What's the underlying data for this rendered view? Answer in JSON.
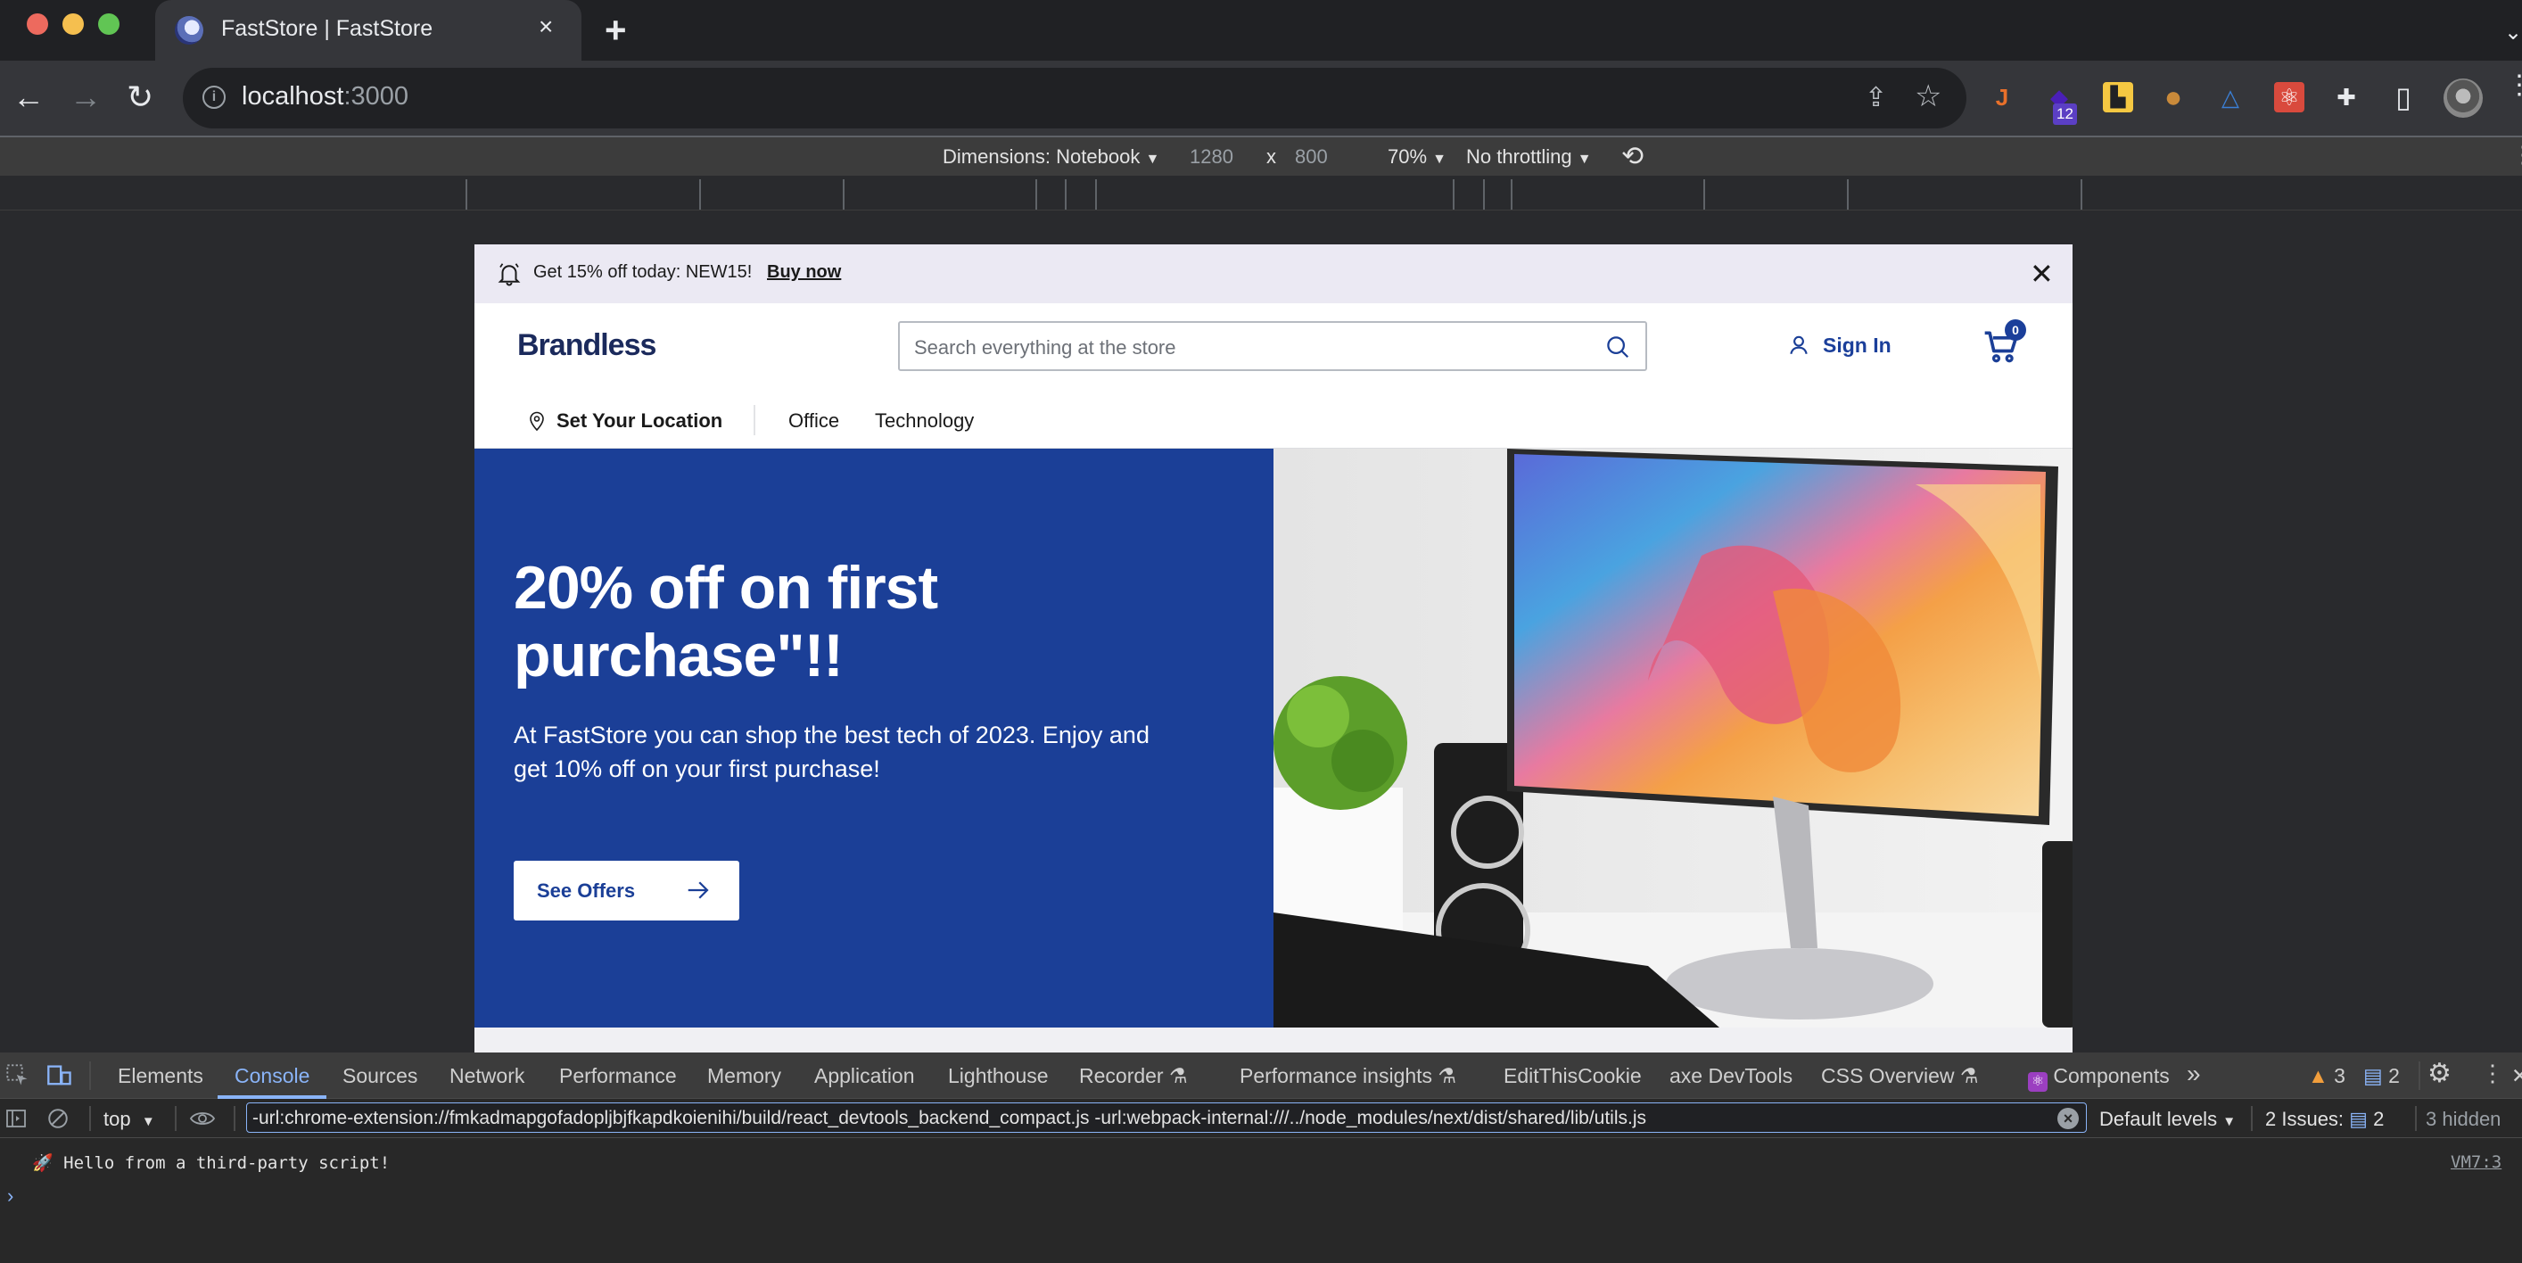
{
  "browser": {
    "tab": {
      "title": "FastStore | FastStore",
      "close_glyph": "×"
    },
    "new_tab_glyph": "+",
    "tab_menu_glyph": "⌄",
    "nav": {
      "back_glyph": "←",
      "forward_glyph": "→",
      "reload_glyph": "↻"
    },
    "address": {
      "host": "localhost",
      "port": ":3000",
      "info_glyph": "i"
    },
    "omnibox_actions": {
      "share_glyph": "⇪",
      "bookmark_glyph": "☆"
    },
    "extensions": [
      {
        "name": "hook-extension",
        "glyph": "J",
        "color": "#e8702a"
      },
      {
        "name": "stacked-cube-extension",
        "glyph": "◆",
        "color": "#4a1fb8",
        "badge": "12"
      },
      {
        "name": "folder-extension",
        "glyph": "▙",
        "color": "#f5c842"
      },
      {
        "name": "editthiscookie-extension",
        "glyph": "●",
        "color": "#c98a3a"
      },
      {
        "name": "axe-devtools-extension",
        "glyph": "△",
        "color": "#3b7fd4"
      },
      {
        "name": "react-devtools-extension",
        "glyph": "⚛",
        "color": "#d94a3d"
      },
      {
        "name": "extensions-puzzle",
        "glyph": "✚",
        "color": "#e8eaed"
      },
      {
        "name": "side-panel",
        "glyph": "▯",
        "color": "#e8eaed"
      }
    ],
    "menu_glyph": "⋮"
  },
  "device_toolbar": {
    "dimensions_label": "Dimensions: Notebook",
    "width": "1280",
    "times_glyph": "x",
    "height": "800",
    "zoom": "70%",
    "throttling": "No throttling",
    "dropdown_glyph": "▼",
    "rotate_glyph": "⟲"
  },
  "store": {
    "alert": {
      "message": "Get 15% off today: NEW15!",
      "link": "Buy now",
      "close_glyph": "✕"
    },
    "header": {
      "logo": "Brandless",
      "search_placeholder": "Search everything at the store",
      "sign_in": "Sign In",
      "cart_count": "0"
    },
    "nav": {
      "location": "Set Your Location",
      "links": [
        "Office",
        "Technology"
      ]
    },
    "hero": {
      "title": "20% off on first purchase\"!!",
      "subtitle": "At FastStore you can shop the best tech of 2023. Enjoy and get 10% off on your first purchase!",
      "cta": "See Offers",
      "image_alt": "Desktop monitor with colorful wallpaper, speakers, plant and keyboard"
    },
    "colors": {
      "brand": "#1b3f97",
      "alert_bg": "#ebe9f3",
      "logo": "#1b2a5c"
    }
  },
  "devtools": {
    "tabs": [
      {
        "label": "Elements"
      },
      {
        "label": "Console",
        "active": true
      },
      {
        "label": "Sources"
      },
      {
        "label": "Network"
      },
      {
        "label": "Performance"
      },
      {
        "label": "Memory"
      },
      {
        "label": "Application"
      },
      {
        "label": "Lighthouse"
      },
      {
        "label": "Recorder ⚗"
      },
      {
        "label": "Performance insights ⚗"
      },
      {
        "label": "EditThisCookie"
      },
      {
        "label": "axe DevTools"
      },
      {
        "label": "CSS Overview ⚗"
      },
      {
        "label": "Components"
      }
    ],
    "more_tabs_glyph": "»",
    "warnings_count": "3",
    "messages_count": "2",
    "context": "top",
    "filter_value": "-url:chrome-extension://fmkadmapgofadopljbjfkapdkoienihi/build/react_devtools_backend_compact.js -url:webpack-internal:///../node_modules/next/dist/shared/lib/utils.js",
    "levels": "Default levels",
    "issues_label": "2 Issues:",
    "issues_count": "2",
    "hidden": "3 hidden",
    "console": {
      "message_icon": "🚀",
      "message": "Hello from a third-party script!",
      "source": "VM7:3",
      "prompt": "›"
    }
  }
}
